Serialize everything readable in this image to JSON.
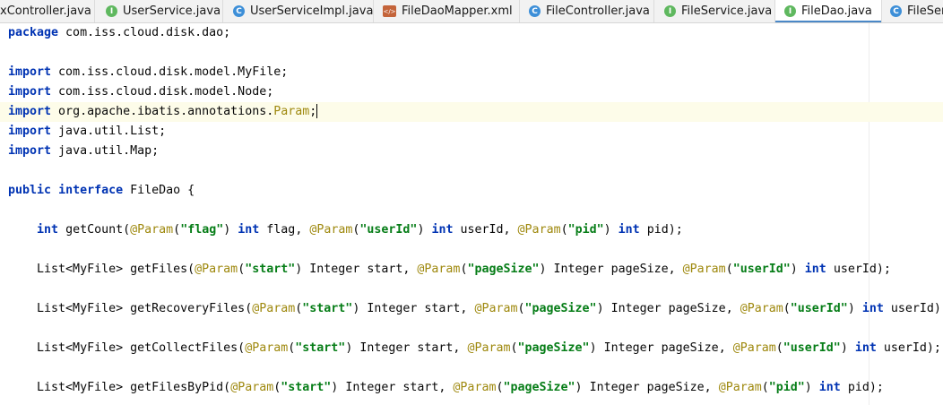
{
  "tabs": [
    {
      "label": "xController.java",
      "icon": "class-icon",
      "close": "×",
      "active": false
    },
    {
      "label": "UserService.java",
      "icon": "interface-icon",
      "active": false
    },
    {
      "label": "UserServiceImpl.java",
      "icon": "class-icon",
      "active": false
    },
    {
      "label": "FileDaoMapper.xml",
      "icon": "xml-icon",
      "active": false
    },
    {
      "label": "FileController.java",
      "icon": "class-icon",
      "active": false
    },
    {
      "label": "FileService.java",
      "icon": "interface-icon",
      "active": false
    },
    {
      "label": "FileDao.java",
      "icon": "interface-icon",
      "active": true
    },
    {
      "label": "FileServ",
      "icon": "class-icon",
      "active": false
    }
  ],
  "editor": {
    "package_kw": "package",
    "package_name": " com.iss.cloud.disk.dao;",
    "import_kw": "import",
    "imports": [
      " com.iss.cloud.disk.model.MyFile;",
      " com.iss.cloud.disk.model.Node;",
      " org.apache.ibatis.annotations.",
      " java.util.List;",
      " java.util.Map;"
    ],
    "import_param": "Param",
    "import_semicolon": ";",
    "public_kw": "public",
    "interface_kw": "interface",
    "interface_name": " FileDao {",
    "methods": [
      {
        "indent": "    ",
        "ret_kw": "int",
        "name": " getCount(",
        "params": [
          {
            "ann": "@Param",
            "open": "(",
            "str": "\"flag\"",
            "close": ") ",
            "type_kw": "int",
            "type": "",
            "var": " flag",
            "sep": ", "
          },
          {
            "ann": "@Param",
            "open": "(",
            "str": "\"userId\"",
            "close": ") ",
            "type_kw": "int",
            "type": "",
            "var": " userId",
            "sep": ", "
          },
          {
            "ann": "@Param",
            "open": "(",
            "str": "\"pid\"",
            "close": ") ",
            "type_kw": "int",
            "type": "",
            "var": " pid",
            "sep": ");"
          }
        ]
      },
      {
        "indent": "    ",
        "ret_kw": "",
        "name": "List<MyFile> getFiles(",
        "params": [
          {
            "ann": "@Param",
            "open": "(",
            "str": "\"start\"",
            "close": ") ",
            "type_kw": "",
            "type": "Integer",
            "var": " start",
            "sep": ", "
          },
          {
            "ann": "@Param",
            "open": "(",
            "str": "\"pageSize\"",
            "close": ") ",
            "type_kw": "",
            "type": "Integer",
            "var": " pageSize",
            "sep": ", "
          },
          {
            "ann": "@Param",
            "open": "(",
            "str": "\"userId\"",
            "close": ") ",
            "type_kw": "int",
            "type": "",
            "var": " userId",
            "sep": ");"
          }
        ]
      },
      {
        "indent": "    ",
        "ret_kw": "",
        "name": "List<MyFile> getRecoveryFiles(",
        "params": [
          {
            "ann": "@Param",
            "open": "(",
            "str": "\"start\"",
            "close": ") ",
            "type_kw": "",
            "type": "Integer",
            "var": " start",
            "sep": ", "
          },
          {
            "ann": "@Param",
            "open": "(",
            "str": "\"pageSize\"",
            "close": ") ",
            "type_kw": "",
            "type": "Integer",
            "var": " pageSize",
            "sep": ", "
          },
          {
            "ann": "@Param",
            "open": "(",
            "str": "\"userId\"",
            "close": ") ",
            "type_kw": "int",
            "type": "",
            "var": " userId",
            "sep": ");"
          }
        ]
      },
      {
        "indent": "    ",
        "ret_kw": "",
        "name": "List<MyFile> getCollectFiles(",
        "params": [
          {
            "ann": "@Param",
            "open": "(",
            "str": "\"start\"",
            "close": ") ",
            "type_kw": "",
            "type": "Integer",
            "var": " start",
            "sep": ", "
          },
          {
            "ann": "@Param",
            "open": "(",
            "str": "\"pageSize\"",
            "close": ") ",
            "type_kw": "",
            "type": "Integer",
            "var": " pageSize",
            "sep": ", "
          },
          {
            "ann": "@Param",
            "open": "(",
            "str": "\"userId\"",
            "close": ") ",
            "type_kw": "int",
            "type": "",
            "var": " userId",
            "sep": ");"
          }
        ]
      },
      {
        "indent": "    ",
        "ret_kw": "",
        "name": "List<MyFile> getFilesByPid(",
        "params": [
          {
            "ann": "@Param",
            "open": "(",
            "str": "\"start\"",
            "close": ") ",
            "type_kw": "",
            "type": "Integer",
            "var": " start",
            "sep": ", "
          },
          {
            "ann": "@Param",
            "open": "(",
            "str": "\"pageSize\"",
            "close": ") ",
            "type_kw": "",
            "type": "Integer",
            "var": " pageSize",
            "sep": ", "
          },
          {
            "ann": "@Param",
            "open": "(",
            "str": "\"pid\"",
            "close": ") ",
            "type_kw": "int",
            "type": "",
            "var": " pid",
            "sep": ");"
          }
        ]
      }
    ]
  }
}
